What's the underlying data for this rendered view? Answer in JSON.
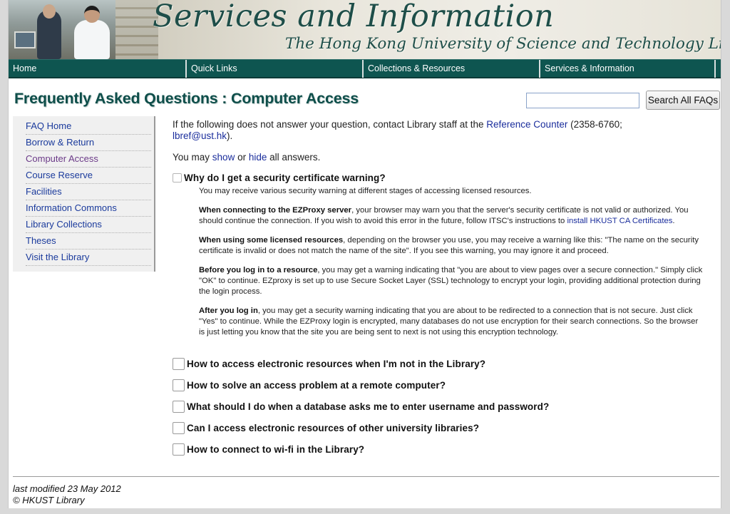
{
  "banner": {
    "title": "Services and Information",
    "subtitle": "The Hong Kong University of Science and Technology Library"
  },
  "nav": {
    "items": [
      {
        "label": "Home"
      },
      {
        "label": "Quick Links"
      },
      {
        "label": "Collections & Resources"
      },
      {
        "label": "Services & Information"
      }
    ]
  },
  "header": {
    "title": "Frequently Asked Questions : Computer Access",
    "search": {
      "value": "",
      "button_label": "Search All FAQs"
    }
  },
  "sidebar": {
    "items": [
      {
        "label": "FAQ Home"
      },
      {
        "label": "Borrow & Return"
      },
      {
        "label": "Computer Access",
        "active": true
      },
      {
        "label": "Course Reserve"
      },
      {
        "label": "Facilities"
      },
      {
        "label": "Information Commons"
      },
      {
        "label": "Library Collections"
      },
      {
        "label": "Theses"
      },
      {
        "label": "Visit the Library"
      }
    ]
  },
  "intro": {
    "text_before": "If the following does not answer your question, contact Library staff at the ",
    "reference_link": "Reference Counter",
    "text_phone": " (2358-6760; ",
    "email_link": "lbref@ust.hk",
    "text_after": ")."
  },
  "toggle": {
    "prefix": "You may ",
    "show": "show",
    "middle": " or ",
    "hide": "hide",
    "suffix": " all answers."
  },
  "questions": [
    {
      "text": "Why do I get a security certificate warning?",
      "expanded": true
    },
    {
      "text": "How to access electronic resources when I'm not in the Library?",
      "expanded": false
    },
    {
      "text": "How to solve an access problem at a remote computer?",
      "expanded": false
    },
    {
      "text": "What should I do when a database asks me to enter username and password?",
      "expanded": false
    },
    {
      "text": "Can I access electronic resources of other university libraries?",
      "expanded": false
    },
    {
      "text": "How to connect to wi-fi in the Library?",
      "expanded": false
    }
  ],
  "answer": {
    "p1": "You may receive various security warning at different stages of accessing licensed resources.",
    "p2_bold_a": "When connecting to the ",
    "p2_ezproxy": "EZProxy",
    "p2_bold_b": " server",
    "p2_text": ", your browser may warn you that the server's security certificate is not valid or authorized. You should continue the connection. If you wish to avoid this error in the future, follow ITSC's instructions to ",
    "p2_link": "install HKUST CA Certificates",
    "p2_end": ".",
    "p3_bold": "When using some licensed resources",
    "p3_text": ", depending on the browser you use, you may receive a warning like this: \"The name on the security certificate is invalid or does not match the name of the site\". If you see this warning, you may ignore it and proceed.",
    "p4_bold": "Before you log in to a resource",
    "p4_text": ", you may get a warning indicating that \"you are about to view pages over a secure connection.\" Simply click \"OK\" to continue. EZproxy is set up to use Secure Socket Layer (SSL) technology to encrypt your login, providing additional protection during the login process.",
    "p5_bold": "After you log in",
    "p5_text": ", you may get a security warning indicating that you are about to be redirected to a connection that is not secure. Just click \"Yes\" to continue. While the EZProxy login is encrypted, many databases do not use encryption for their search connections. So the browser is just letting you know that the site you are being sent to next is not using this encryption technology."
  },
  "footer": {
    "modified": "last modified 23 May 2012",
    "copyright": "© HKUST Library"
  }
}
